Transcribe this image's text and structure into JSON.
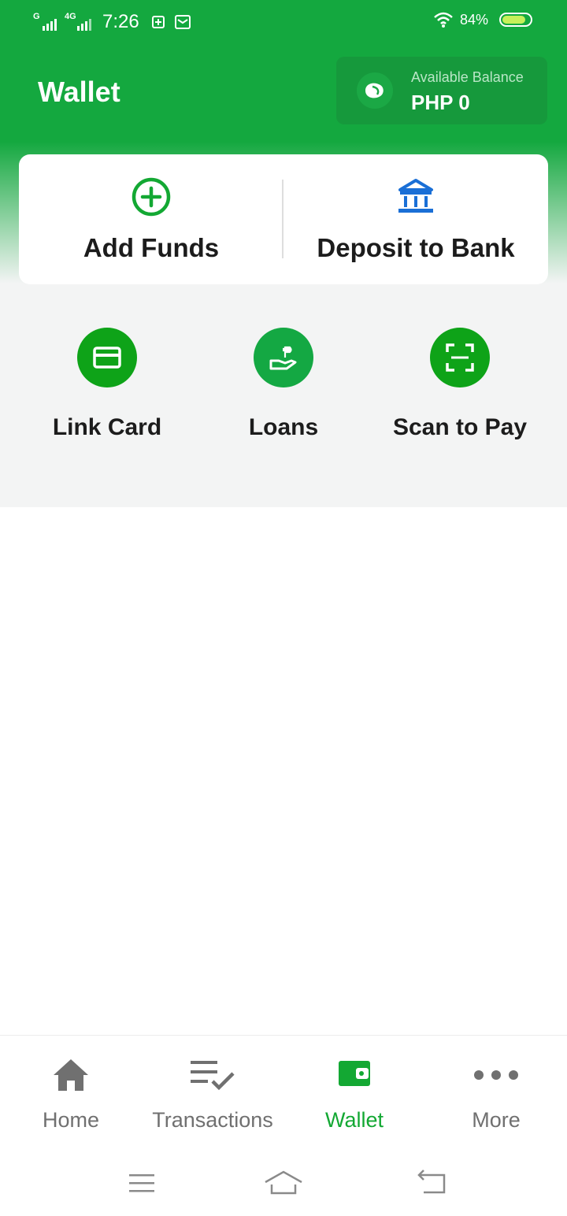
{
  "status_bar": {
    "network1": "G",
    "network2": "4G",
    "time": "7:26",
    "battery_percent": "84%",
    "battery_level": 0.84
  },
  "header": {
    "title": "Wallet",
    "balance_label": "Available Balance",
    "balance_value": "PHP 0"
  },
  "actions": [
    {
      "label": "Add Funds",
      "icon": "plus-circle-icon"
    },
    {
      "label": "Deposit to Bank",
      "icon": "bank-icon"
    }
  ],
  "quick_actions": [
    {
      "label": "Link Card",
      "icon": "credit-card-icon"
    },
    {
      "label": "Loans",
      "icon": "loan-hand-icon"
    },
    {
      "label": "Scan to Pay",
      "icon": "scan-icon"
    }
  ],
  "bottom_nav": [
    {
      "label": "Home",
      "icon": "home-icon",
      "active": false
    },
    {
      "label": "Transactions",
      "icon": "transactions-icon",
      "active": false
    },
    {
      "label": "Wallet",
      "icon": "wallet-icon",
      "active": true
    },
    {
      "label": "More",
      "icon": "more-icon",
      "active": false
    }
  ],
  "colors": {
    "brand_green": "#14a83f",
    "active_green": "#13a833",
    "bank_blue": "#1a6fd6",
    "inactive_gray": "#707070"
  }
}
